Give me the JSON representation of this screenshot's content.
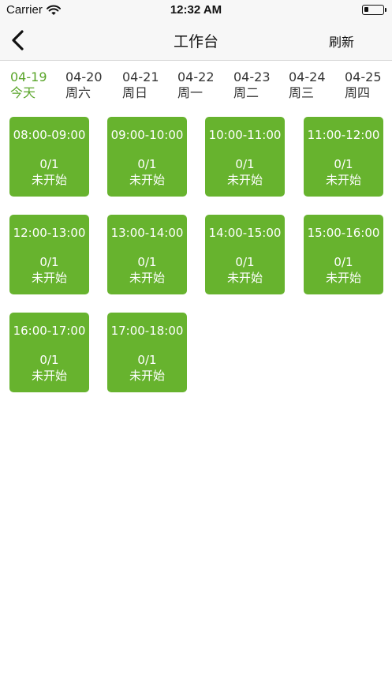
{
  "status_bar": {
    "carrier": "Carrier",
    "time": "12:32 AM",
    "battery_level": 0.2
  },
  "nav": {
    "title": "工作台",
    "refresh_label": "刷新"
  },
  "date_tabs": [
    {
      "date": "04-19",
      "day": "今天",
      "active": true
    },
    {
      "date": "04-20",
      "day": "周六",
      "active": false
    },
    {
      "date": "04-21",
      "day": "周日",
      "active": false
    },
    {
      "date": "04-22",
      "day": "周一",
      "active": false
    },
    {
      "date": "04-23",
      "day": "周二",
      "active": false
    },
    {
      "date": "04-24",
      "day": "周三",
      "active": false
    },
    {
      "date": "04-25",
      "day": "周四",
      "active": false
    }
  ],
  "slots": [
    {
      "range": "08:00-09:00",
      "count": "0/1",
      "state": "未开始"
    },
    {
      "range": "09:00-10:00",
      "count": "0/1",
      "state": "未开始"
    },
    {
      "range": "10:00-11:00",
      "count": "0/1",
      "state": "未开始"
    },
    {
      "range": "11:00-12:00",
      "count": "0/1",
      "state": "未开始"
    },
    {
      "range": "12:00-13:00",
      "count": "0/1",
      "state": "未开始"
    },
    {
      "range": "13:00-14:00",
      "count": "0/1",
      "state": "未开始"
    },
    {
      "range": "14:00-15:00",
      "count": "0/1",
      "state": "未开始"
    },
    {
      "range": "15:00-16:00",
      "count": "0/1",
      "state": "未开始"
    },
    {
      "range": "16:00-17:00",
      "count": "0/1",
      "state": "未开始"
    },
    {
      "range": "17:00-18:00",
      "count": "0/1",
      "state": "未开始"
    }
  ],
  "colors": {
    "accent": "#5aa52a",
    "slot_background": "#67b32e"
  },
  "icons": {
    "back": "chevron-left-icon",
    "wifi": "wifi-icon",
    "battery": "battery-icon"
  }
}
